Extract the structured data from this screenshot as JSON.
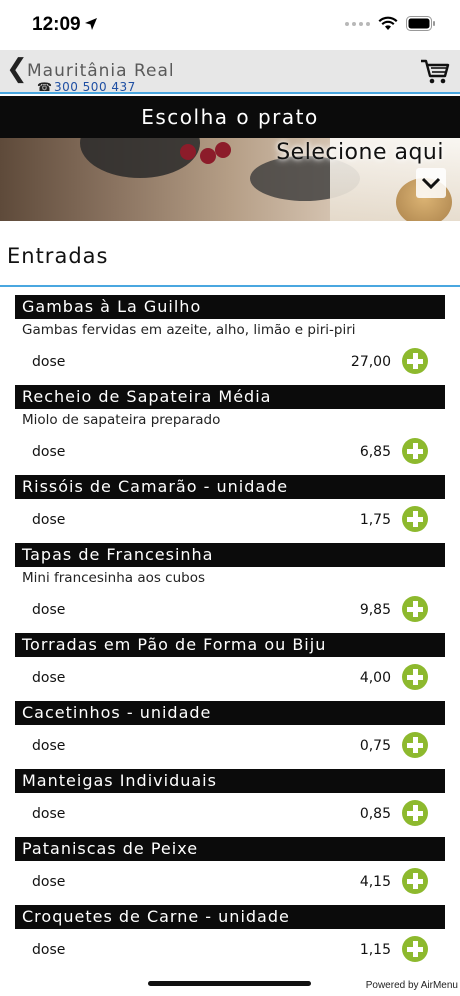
{
  "status": {
    "time": "12:09"
  },
  "header": {
    "back_icon": "chevron-left-icon",
    "store_name": "Mauritânia Real",
    "phone": "300 500 437",
    "cart_icon": "cart-icon"
  },
  "title_bar": {
    "title": "Escolha o prato"
  },
  "banner": {
    "select_label": "Selecione aqui"
  },
  "section": {
    "title": "Entradas"
  },
  "colors": {
    "accent": "#4aa7e0",
    "add_button": "#8db92e",
    "bar": "#0b0b0b"
  },
  "items": [
    {
      "name": "Gambas à La Guilho",
      "desc": "Gambas fervidas em azeite, alho, limão e piri-piri",
      "dose": "dose",
      "price": "27,00"
    },
    {
      "name": "Recheio de Sapateira Média",
      "desc": "Miolo de sapateira preparado",
      "dose": "dose",
      "price": "6,85"
    },
    {
      "name": "Rissóis de Camarão - unidade",
      "desc": "",
      "dose": "dose",
      "price": "1,75"
    },
    {
      "name": "Tapas de Francesinha",
      "desc": "Mini francesinha aos cubos",
      "dose": "dose",
      "price": "9,85"
    },
    {
      "name": "Torradas em Pão de Forma ou Biju",
      "desc": "",
      "dose": "dose",
      "price": "4,00"
    },
    {
      "name": "Cacetinhos - unidade",
      "desc": "",
      "dose": "dose",
      "price": "0,75"
    },
    {
      "name": "Manteigas Individuais",
      "desc": "",
      "dose": "dose",
      "price": "0,85"
    },
    {
      "name": "Pataniscas de Peixe",
      "desc": "",
      "dose": "dose",
      "price": "4,15"
    },
    {
      "name": "Croquetes de Carne - unidade",
      "desc": "",
      "dose": "dose",
      "price": "1,15"
    }
  ],
  "footer": {
    "powered_by": "Powered by AirMenu"
  }
}
